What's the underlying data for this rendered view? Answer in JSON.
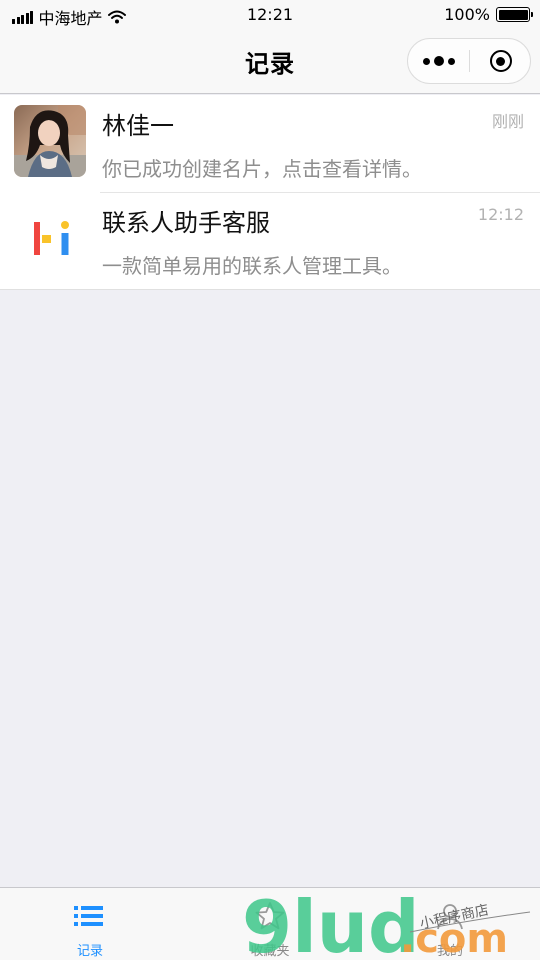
{
  "status_bar": {
    "carrier": "中海地产",
    "time": "12:21",
    "battery": "100%",
    "icons": [
      "signal-icon",
      "wifi-icon",
      "battery-icon"
    ]
  },
  "nav": {
    "title": "记录",
    "capsule_icons": [
      "more-dots-icon",
      "close-target-icon"
    ]
  },
  "records": [
    {
      "name": "林佳一",
      "description": "你已成功创建名片，点击查看详情。",
      "time": "刚刚",
      "avatar": "user-photo"
    },
    {
      "name": "联系人助手客服",
      "description": "一款简单易用的联系人管理工具。",
      "time": "12:12",
      "avatar": "hi-logo"
    }
  ],
  "tabs": [
    {
      "label": "记录",
      "icon": "list-icon",
      "active": true
    },
    {
      "label": "收藏夹",
      "icon": "star-icon",
      "active": false
    },
    {
      "label": "我的",
      "icon": "user-icon",
      "active": false
    }
  ],
  "watermark": {
    "brand": "9lud",
    "suffix": ".com",
    "caption": "小程序商店"
  },
  "colors": {
    "accent": "#1e90ff",
    "background": "#efeff4",
    "logo_red": "#f0453f",
    "logo_yellow": "#f9c32a",
    "logo_blue": "#2f8ff0",
    "watermark_green": "#3ec78a",
    "watermark_orange": "#f39a3c"
  }
}
